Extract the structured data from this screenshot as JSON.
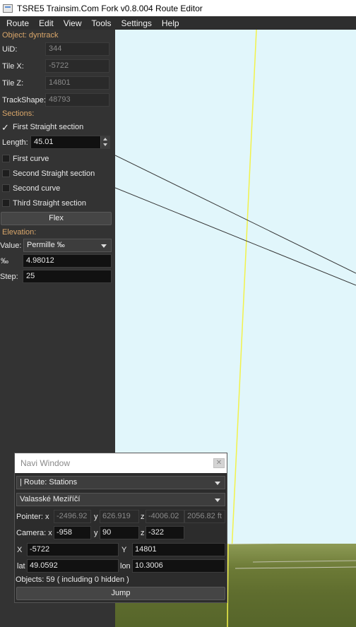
{
  "window": {
    "title": "TSRE5 Trainsim.Com Fork v0.8.004 Route Editor"
  },
  "menu": [
    "Route",
    "Edit",
    "View",
    "Tools",
    "Settings",
    "Help"
  ],
  "object_section": "Object: dyntrack",
  "fields": {
    "uid_label": "UiD:",
    "uid": "344",
    "tilex_label": "Tile X:",
    "tilex": "-5722",
    "tilez_label": "Tile Z:",
    "tilez": "14801",
    "trackshape_label": "TrackShape:",
    "trackshape": "48793"
  },
  "sections_label": "Sections:",
  "sections": {
    "first_straight": "First Straight section",
    "length_label": "Length:",
    "length": "45.01",
    "first_curve": "First curve",
    "second_straight": "Second Straight section",
    "second_curve": "Second curve",
    "third_straight": "Third Straight section",
    "flex_button": "Flex"
  },
  "elevation": {
    "label": "Elevation:",
    "value_label": "Value:",
    "value_select": "Permille ‰",
    "permille_label": "‰",
    "permille": "4.98012",
    "step_label": "Step:",
    "step": "25"
  },
  "navi": {
    "title": "Navi Window",
    "route_select": "| Route: Stations",
    "station_select": "Valasské Meziříčí",
    "pointer_label": "Pointer: x",
    "pointer_x": "-2496.92",
    "y_label": "y",
    "pointer_y": "626.919",
    "z_label": "z",
    "pointer_z": "-4006.02",
    "pointer_ft": "2056.82 ft",
    "camera_label": "Camera: x",
    "camera_x": "-958",
    "camera_y": "90",
    "camera_z": "-322",
    "X_label": "X",
    "X": "-5722",
    "Y_label": "Y",
    "Y": "14801",
    "lat_label": "lat",
    "lat": "49.0592",
    "lon_label": "lon",
    "lon": "10.3006",
    "objects": "Objects: 59 ( including 0 hidden )",
    "jump": "Jump"
  },
  "colors": {
    "section_accent": "#d9a66a",
    "sky": "#e1f6fb",
    "track_line": "#f2f24a"
  }
}
